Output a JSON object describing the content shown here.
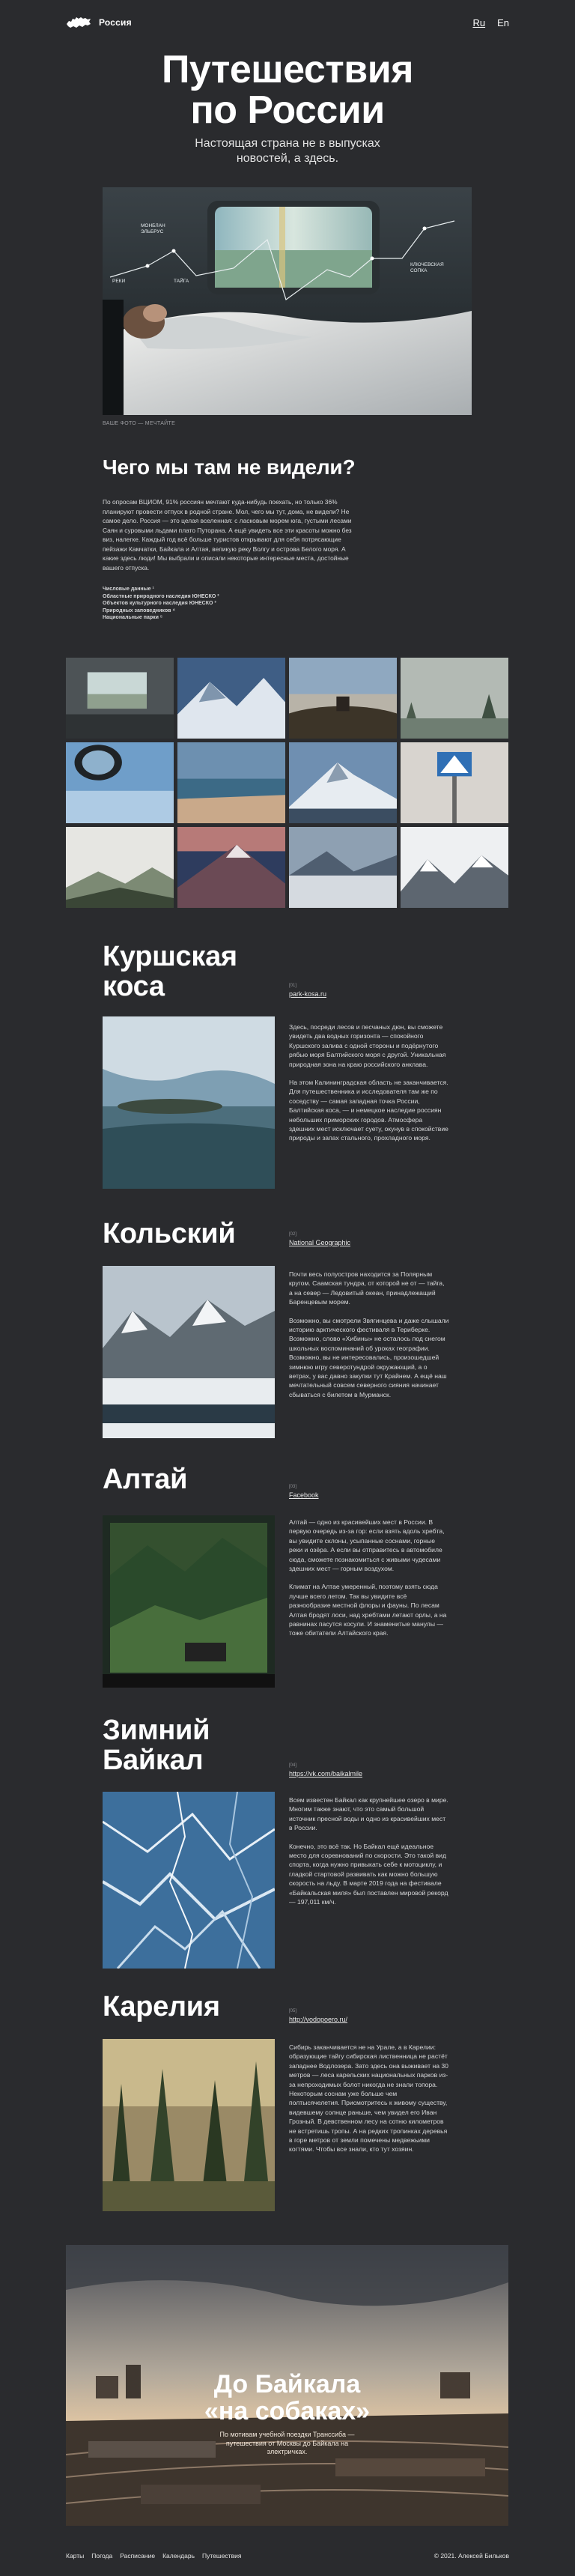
{
  "header": {
    "brand": "Россия",
    "lang_ru": "Ru",
    "lang_en": "En"
  },
  "hero": {
    "title_line1": "Путешествия",
    "title_line2": "по России",
    "subtitle": "Настоящая страна не в выпусках новостей, а здесь.",
    "photo_caption": "ВАШЕ ФОТО — МЕЧТАЙТЕ",
    "chart_labels": [
      "МОНБЛАН",
      "ЭЛЬБРУС",
      "РЕКИ",
      "ТАЙГА",
      "КЛЮЧЕВСКАЯ",
      "СОПКА"
    ]
  },
  "intro": {
    "heading": "Чего мы там не видели?",
    "text": "По опросам ВЦИОМ, 91% россиян мечтают куда-нибудь поехать, но только 36% планируют провести отпуск в родной стране. Мол, чего мы тут, дома, не видели? Не самое дело. Россия — это целая вселенная: с ласковым морем юга, густыми лесами Саян и суровыми льдами плато Путорана. А ещё увидеть все эти красоты можно без виз, налегке. Каждый год всё больше туристов открывают для себя потрясающие пейзажи Камчатки, Байкала и Алтая, великую реку Волгу и острова Белого моря. А какие здесь люди! Мы выбрали и описали некоторые интересные места, достойные вашего отпуска.",
    "notes": [
      "Числовые данные ¹",
      "Областные природного наследия ЮНЕСКО ²",
      "Объектов культурного наследия ЮНЕСКО ³",
      "Природных заповедников ⁴",
      "Национальные парки ⁵"
    ]
  },
  "destinations": [
    {
      "title_line1": "Куршская",
      "title_line2": "коса",
      "num": "[01]",
      "link": "park-kosa.ru",
      "paragraphs": [
        "Здесь, посреди лесов и песчаных дюн, вы сможете увидеть два водных горизонта — спокойного Куршского залива с одной стороны и подёрнутого рябью моря Балтийского моря с другой. Уникальная природная зона на краю российского анклава.",
        "На этом Калининградская область не заканчивается. Для путешественника и исследователя там же по соседству — самая западная точка России, Балтийская коса, — и немецкое наследие россиян небольших приморских городов. Атмосфера здешних мест исключает суету, окунув в спокойствие природы и запах стального, прохладного моря."
      ]
    },
    {
      "title_line1": "Кольский",
      "title_line2": "",
      "num": "[02]",
      "link": "National Geographic",
      "paragraphs": [
        "Почти весь полуостров находится за Полярным кругом. Саамская тундра, от которой не от — тайга, а на север — Ледовитый океан, принадлежащий Баренцевым морем.",
        "Возможно, вы смотрели Звягинцева и даже слышали историю арктического фестиваля в Териберке. Возможно, слово «Хибины» не осталось под снегом школьных воспоминаний об уроках географии. Возможно, вы не интересовались, произошедшей зимнюю игру северотундрой окружающий, а о ветрах, у вас давно закупки тут Крайнем. А ещё наш мечтательный совсем северного сияния начинает сбываться с билетом в Мурманск."
      ]
    },
    {
      "title_line1": "Алтай",
      "title_line2": "",
      "num": "[03]",
      "link": "Facebook",
      "paragraphs": [
        "Алтай — одно из красивейших мест в России. В первую очередь из-за гор: если взять вдоль хребта, вы увидите склоны, усыпанные соснами, горные реки и озёра. А если вы отправитесь в автомобиле сюда, сможете познакомиться с живыми чудесами здешних мест — горным воздухом.",
        "Климат на Алтае умеренный, поэтому взять сюда лучше всего летом. Так вы увидите всё разнообразие местной флоры и фауны. По лесам Алтая бродят лоси, над хребтами летают орлы, а на равнинах пасутся косули. И знаменитые манулы — тоже обитатели Алтайского края."
      ]
    },
    {
      "title_line1": "Зимний",
      "title_line2": "Байкал",
      "num": "[04]",
      "link": "https://vk.com/baikalmile",
      "paragraphs": [
        "Всем известен Байкал как крупнейшее озеро в мире. Многим также знают, что это самый большой источник пресной воды и одно из красивейших мест в России.",
        "Конечно, это всё так. Но Байкал ещё идеальное место для соревнований по скорости. Это такой вид спорта, когда нужно привыкать себе к мотоциклу, и гладкой стартовой развивать как можно большую скорость на льду. В марте 2019 года на фестивале «Байкальская миля» был поставлен мировой рекорд — 197,011 км/ч."
      ]
    },
    {
      "title_line1": "Карелия",
      "title_line2": "",
      "num": "[05]",
      "link": "http://vodopoero.ru/",
      "paragraphs": [
        "Сибирь заканчивается не на Урале, а в Карелии: образующие тайгу сибирская лиственница не растёт западнее Водлозера. Зато здесь она выживает на 30 метров — леса карельских национальных парков из-за непроходимых болот никогда не знали топора. Некоторым соснам уже больше чем полтысячелетия. Присмотритесь к живому существу, видевшему солнце раньше, чем увидел его Иван Грозный. В девственном лесу на сотню километров не встретишь тропы. А на редких тропинках деревья в горе метров от земли помечены медвежьими когтями. Чтобы все знали, кто тут хозяин."
      ]
    }
  ],
  "promo": {
    "title_line1": "До Байкала",
    "title_line2": "«на собаках»",
    "subtitle": "По мотивам учебной поездки Транссиба — путешествия от Москвы до Байкала на электричках."
  },
  "footer": {
    "links": [
      "Карты",
      "Погода",
      "Расписание",
      "Календарь",
      "Путешествия"
    ],
    "copyright": "© 2021. Алексей Бильков"
  },
  "colors": {
    "background": "#2a2b2e",
    "text": "#ffffff",
    "muted": "#d7d8da"
  }
}
